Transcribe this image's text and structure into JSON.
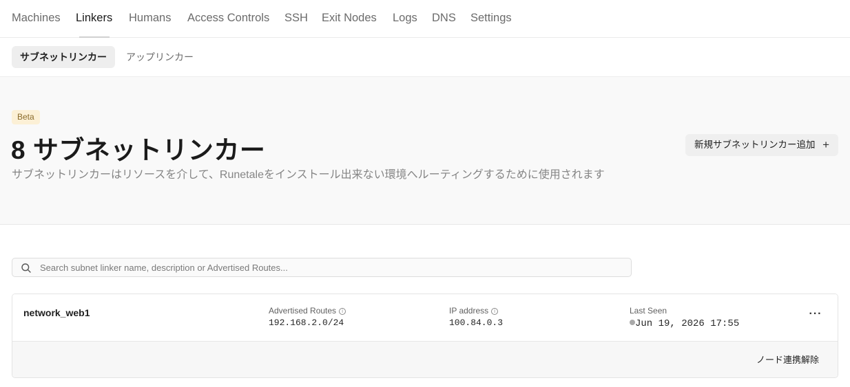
{
  "top_nav": {
    "tabs": [
      "Machines",
      "Linkers",
      "Humans",
      "Access Controls",
      "SSH",
      "Exit Nodes",
      "Logs",
      "DNS",
      "Settings"
    ],
    "active": "Linkers"
  },
  "sub_nav": {
    "tabs": [
      "サブネットリンカー",
      "アップリンカー"
    ],
    "active": "サブネットリンカー"
  },
  "hero": {
    "badge": "Beta",
    "title": "8 サブネットリンカー",
    "description": "サブネットリンカーはリソースを介して、Runetaleをインストール出来ない環境へルーティングするために使用されます",
    "add_button": "新規サブネットリンカー追加",
    "add_icon": "plus-icon"
  },
  "search": {
    "placeholder": "Search subnet linker name, description or Advertised Routes...",
    "value": "",
    "icon": "search-icon"
  },
  "linkers": [
    {
      "name": "network_web1",
      "routes_label": "Advertised Routes",
      "routes": "192.168.2.0/24",
      "ip_label": "IP address",
      "ip": "100.84.0.3",
      "seen_label": "Last Seen",
      "seen": "Jun 19, 2026 17:55",
      "status_color": "#a9a9a9",
      "more_icon": "more-horizontal-icon",
      "unlink_label": "ノード連携解除"
    }
  ],
  "colors": {
    "beta_bg": "#fcf0d6",
    "beta_text": "#8a6a2a",
    "hero_bg": "#f9f9f9"
  }
}
